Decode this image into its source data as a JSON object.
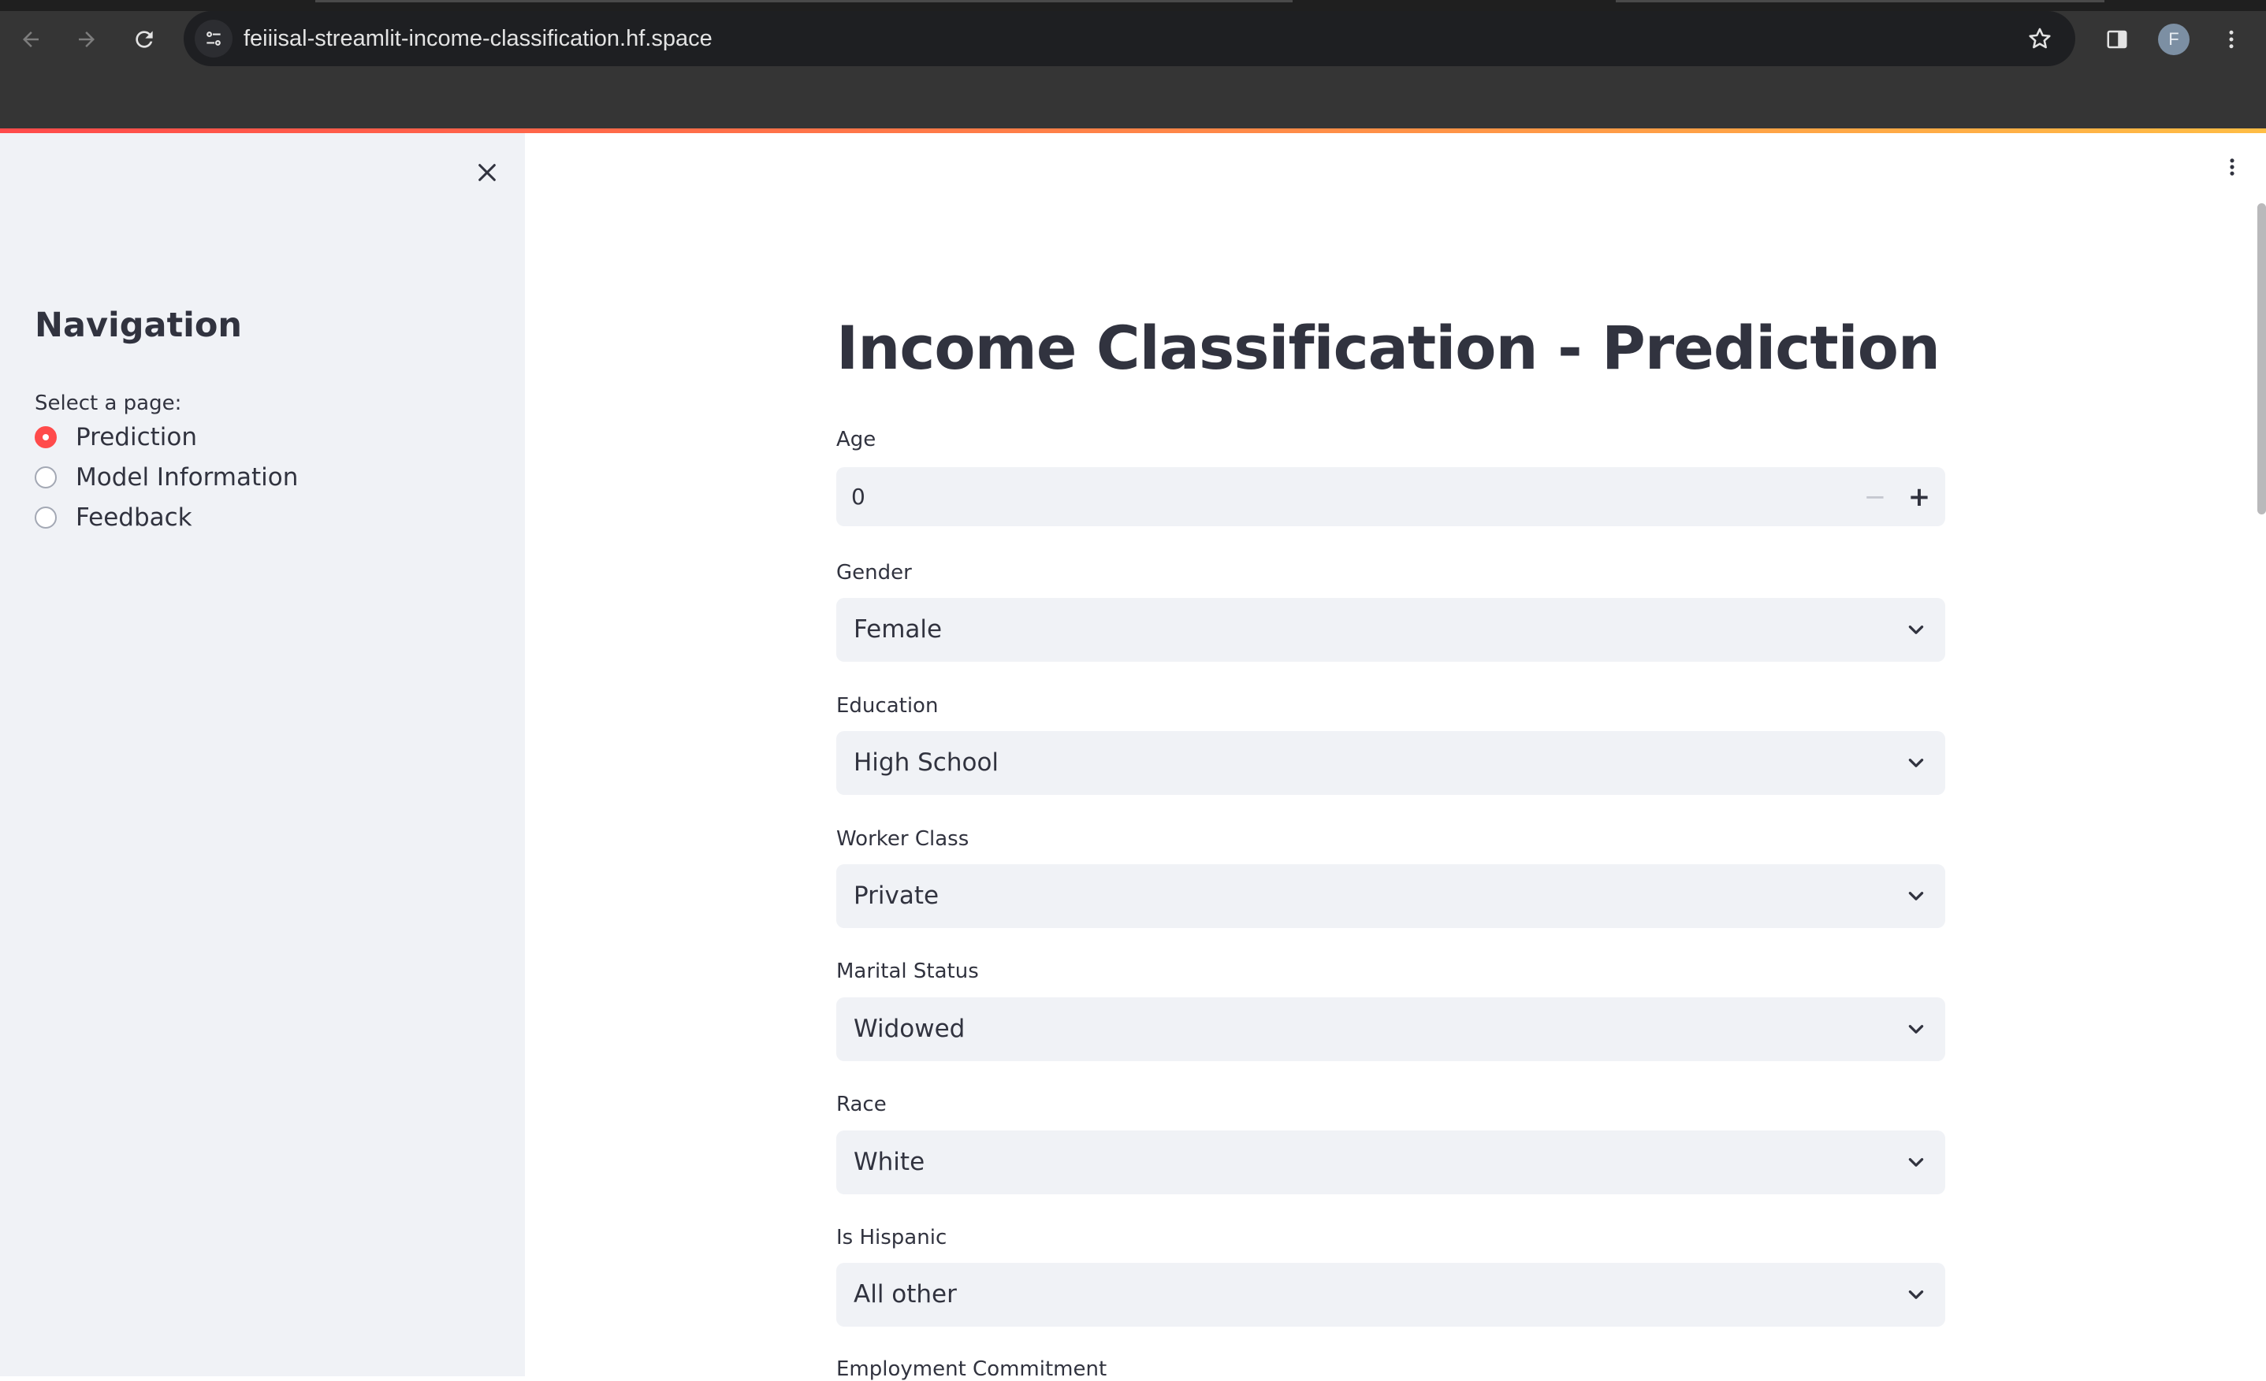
{
  "browser": {
    "url": "feiiisal-streamlit-income-classification.hf.space",
    "profile_initial": "F",
    "icons": {
      "back": "arrow-left-icon",
      "forward": "arrow-right-icon",
      "reload": "reload-icon",
      "site_info": "tune-icon",
      "bookmark": "star-icon",
      "side_panel": "side-panel-icon",
      "menu": "kebab-menu-icon"
    },
    "accent_gradient": [
      "#ff4b4b",
      "#ffbd45"
    ]
  },
  "sidebar": {
    "title": "Navigation",
    "radio_label": "Select a page:",
    "options": [
      {
        "label": "Prediction",
        "selected": true
      },
      {
        "label": "Model Information",
        "selected": false
      },
      {
        "label": "Feedback",
        "selected": false
      }
    ],
    "accent_color": "#ff4b4b",
    "close_icon": "close-icon"
  },
  "main": {
    "title": "Income Classification - Prediction",
    "age": {
      "label": "Age",
      "value": "0",
      "minus": "−",
      "plus": "+"
    },
    "selects": [
      {
        "label": "Gender",
        "value": "Female"
      },
      {
        "label": "Education",
        "value": "High School"
      },
      {
        "label": "Worker Class",
        "value": "Private"
      },
      {
        "label": "Marital Status",
        "value": "Widowed"
      },
      {
        "label": "Race",
        "value": "White"
      },
      {
        "label": "Is Hispanic",
        "value": "All other"
      }
    ],
    "next_label": "Employment Commitment",
    "menu_icon": "kebab-menu-icon"
  }
}
